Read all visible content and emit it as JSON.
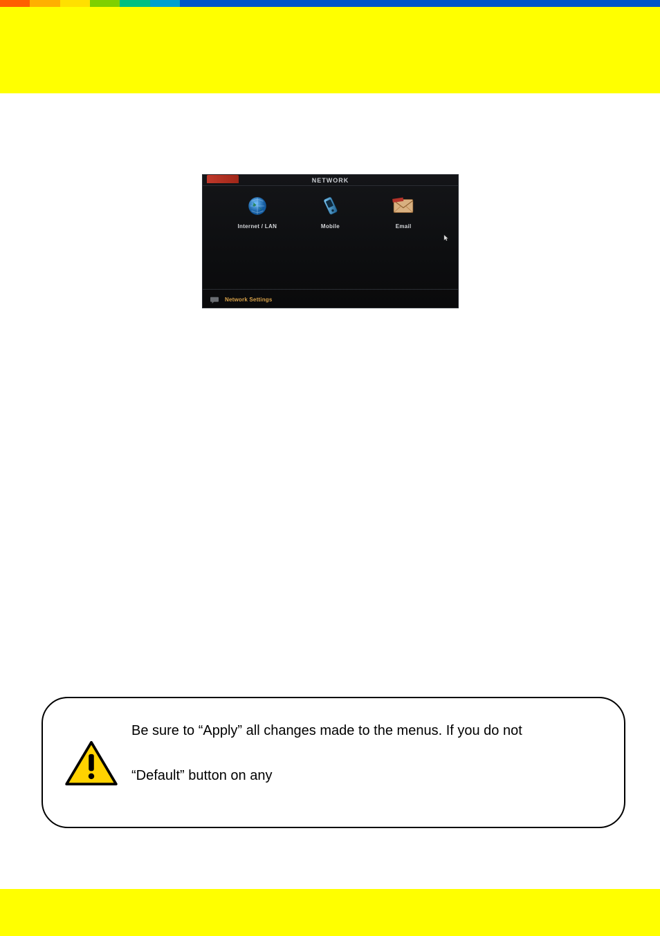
{
  "screenshot": {
    "title": "NETWORK",
    "items": [
      {
        "label": "Internet  /  LAN",
        "icon": "globe"
      },
      {
        "label": "Mobile",
        "icon": "phone"
      },
      {
        "label": "Email",
        "icon": "mail"
      }
    ],
    "footer": "Network  Settings"
  },
  "callout": {
    "line1": "Be sure to “Apply” all changes made to the menus. If you do not",
    "line2": "“Default” button on any"
  }
}
